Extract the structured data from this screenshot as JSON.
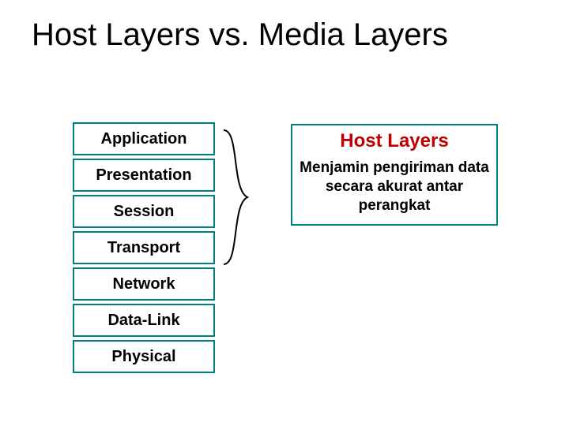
{
  "title": "Host Layers vs. Media Layers",
  "layers": [
    {
      "name": "Application"
    },
    {
      "name": "Presentation"
    },
    {
      "name": "Session"
    },
    {
      "name": "Transport"
    },
    {
      "name": "Network"
    },
    {
      "name": "Data-Link"
    },
    {
      "name": "Physical"
    }
  ],
  "right": {
    "heading": "Host Layers",
    "description": "Menjamin pengiriman data secara akurat antar perangkat"
  }
}
